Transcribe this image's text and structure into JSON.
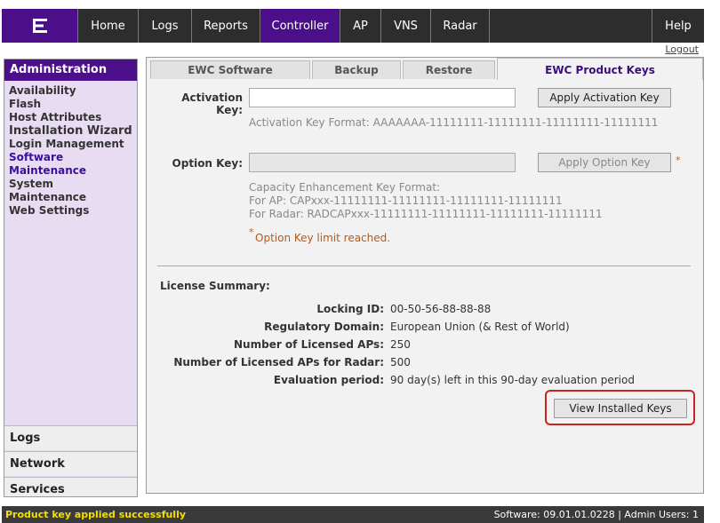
{
  "nav": {
    "items": [
      {
        "label": "Home",
        "active": false
      },
      {
        "label": "Logs",
        "active": false
      },
      {
        "label": "Reports",
        "active": false
      },
      {
        "label": "Controller",
        "active": true
      },
      {
        "label": "AP",
        "active": false
      },
      {
        "label": "VNS",
        "active": false
      },
      {
        "label": "Radar",
        "active": false
      }
    ],
    "help": "Help",
    "logout": "Logout"
  },
  "sidebar": {
    "title": "Administration",
    "items": [
      "Availability",
      "Flash",
      "Host Attributes",
      "Installation Wizard",
      "Login Management",
      "Software Maintenance",
      "System Maintenance",
      "Web Settings"
    ],
    "active_item": "Software Maintenance",
    "sections": [
      "Logs",
      "Network",
      "Services"
    ]
  },
  "tabs": [
    "EWC Software",
    "Backup",
    "Restore",
    "EWC Product Keys"
  ],
  "active_tab": "EWC Product Keys",
  "activation": {
    "label": "Activation Key:",
    "value": "",
    "button": "Apply Activation Key",
    "format": "Activation Key Format: AAAAAAA-11111111-11111111-11111111-11111111"
  },
  "option": {
    "label": "Option Key:",
    "value": "",
    "button": "Apply Option Key",
    "star": "*",
    "format_title": "Capacity Enhancement Key Format:",
    "format_ap": "For AP: CAPxxx-11111111-11111111-11111111-11111111",
    "format_radar": "For Radar: RADCAPxxx-11111111-11111111-11111111-11111111",
    "limit_star": "*",
    "limit_msg": "Option Key limit reached."
  },
  "summary": {
    "title": "License Summary:",
    "rows": [
      {
        "k": "Locking ID:",
        "v": "00-50-56-88-88-88"
      },
      {
        "k": "Regulatory Domain:",
        "v": "European Union (& Rest of World)"
      },
      {
        "k": "Number of Licensed APs:",
        "v": "250"
      },
      {
        "k": "Number of Licensed APs for Radar:",
        "v": "500"
      },
      {
        "k": "Evaluation period:",
        "v": "90 day(s) left in this 90-day evaluation period"
      }
    ],
    "view_button": "View Installed Keys"
  },
  "status": {
    "message": "Product key applied successfully",
    "info": "Software: 09.01.01.0228 | Admin Users: 1"
  },
  "colors": {
    "brand": "#4b0f8a",
    "nav_bg": "#2d2d2d",
    "sidebar_bg": "#e8dcf2",
    "highlight": "#cc2222",
    "status_message": "#f4e000"
  }
}
